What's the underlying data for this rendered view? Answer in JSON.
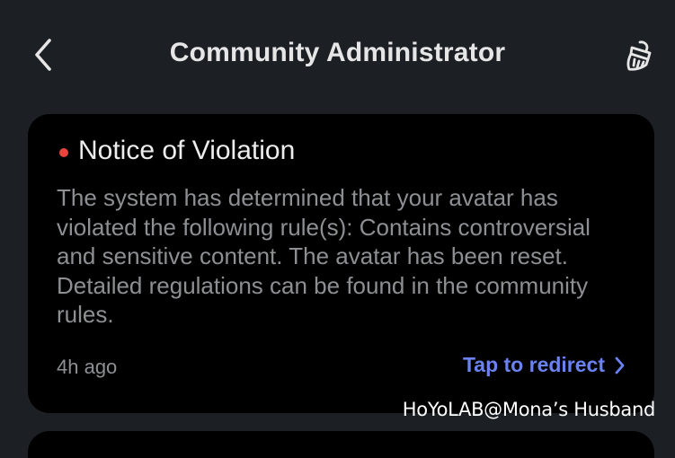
{
  "header": {
    "title": "Community Administrator",
    "back_icon": "chevron-left-icon",
    "action_icon": "broom-icon"
  },
  "notice": {
    "title": "Notice of Violation",
    "body": "The system has determined that your avatar has violated the following rule(s): Contains controversial and sensitive content. The avatar has been reset. Detailed regulations can be found in the community rules.",
    "time": "4h ago",
    "action_label": "Tap to redirect",
    "unread_color": "#e8453c",
    "action_color": "#6a82f2"
  },
  "watermark": "HoYoLAB@Mona’s Husband"
}
